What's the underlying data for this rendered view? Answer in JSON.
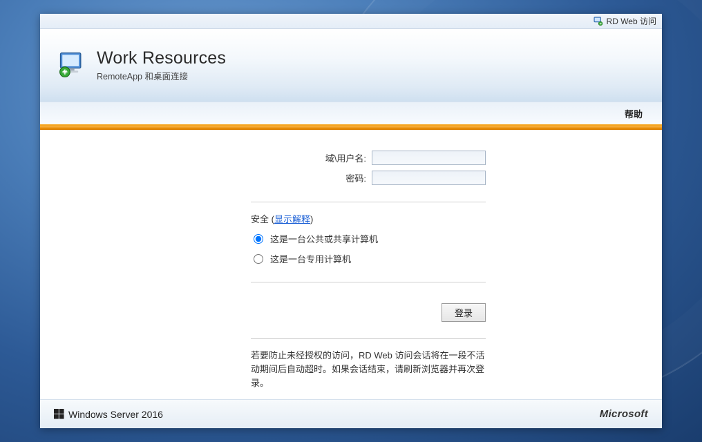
{
  "topbar": {
    "label": "RD Web 访问"
  },
  "header": {
    "title": "Work Resources",
    "subtitle": "RemoteApp 和桌面连接"
  },
  "menubar": {
    "help": "帮助"
  },
  "form": {
    "username_label": "域\\用户名:",
    "password_label": "密码:",
    "username_value": "",
    "password_value": ""
  },
  "security": {
    "label_prefix": "安全 (",
    "show_explain": "显示解释",
    "label_suffix": ")",
    "option_public": "这是一台公共或共享计算机",
    "option_private": "这是一台专用计算机",
    "selected": "public"
  },
  "actions": {
    "login": "登录"
  },
  "notice": {
    "text": "若要防止未经授权的访问，RD Web 访问会话将在一段不活动期间后自动超时。如果会话结束，请刷新浏览器并再次登录。"
  },
  "footer": {
    "product": "Windows Server 2016",
    "vendor": "Microsoft"
  }
}
